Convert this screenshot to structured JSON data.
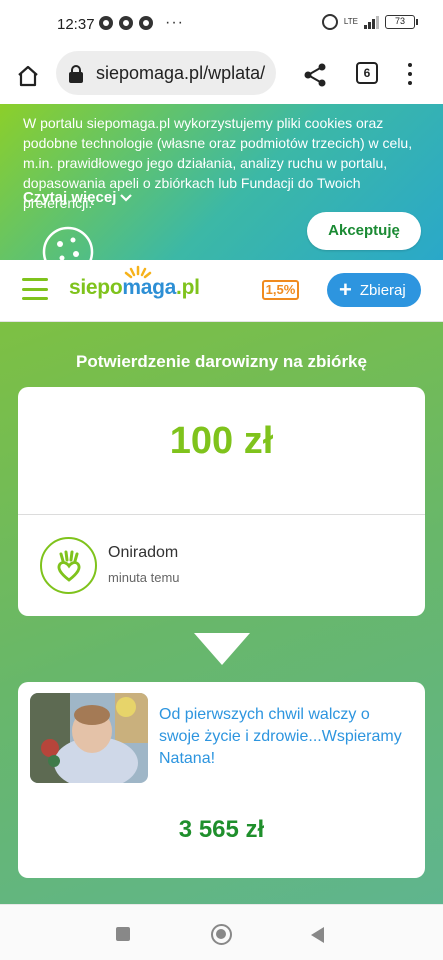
{
  "status_bar": {
    "time": "12:37",
    "network": "LTE",
    "battery": "73"
  },
  "browser": {
    "url": "siepomaga.pl/wplata/",
    "tab_count": "6"
  },
  "cookie_banner": {
    "text": "W portalu siepomaga.pl wykorzystujemy pliki cookies oraz podobne technologie (własne oraz podmiotów trzecich) w celu, m.in. prawidłowego jego działania, analizy ruchu w portalu, dopasowania apeli o zbiórkach lub Fundacji do Twoich preferencji.",
    "read_more": "Czytaj więcej",
    "accept": "Akceptuję"
  },
  "header": {
    "logo_part1": "siepo",
    "logo_part2": "maga",
    "logo_part3": ".pl",
    "tax_badge": "1,5%",
    "collect_button": "Zbieraj"
  },
  "main": {
    "title": "Potwierdzenie darowizny na zbiórkę",
    "amount": "100 zł",
    "donor_name": "Oniradom",
    "donor_time": "minuta temu",
    "campaign_title": "Od pierwszych chwil walczy o swoje życie i zdrowie...Wspieramy Natana!",
    "campaign_amount": "3 565 zł"
  },
  "colors": {
    "brand_green": "#7fc31c",
    "brand_blue": "#2d95df",
    "tax_orange": "#f08b1f",
    "campaign_amount": "#1f8f2c"
  }
}
